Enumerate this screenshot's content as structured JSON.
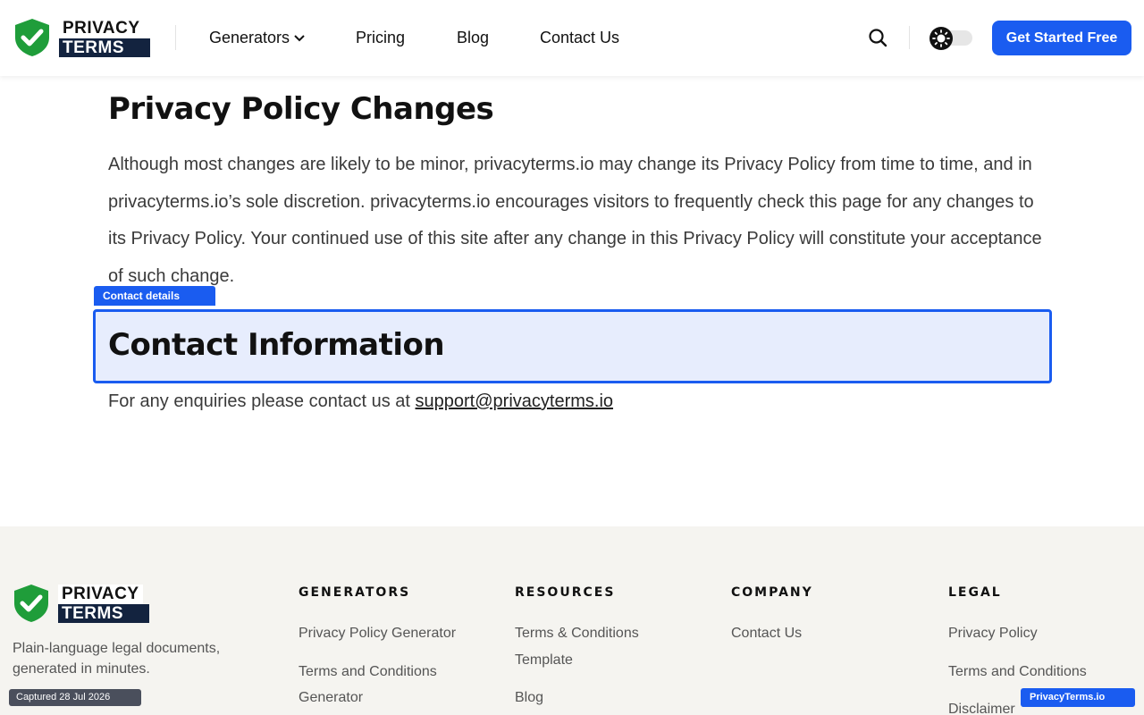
{
  "brand": {
    "word1": "PRIVACY",
    "word2": "TERMS"
  },
  "colors": {
    "accent": "#1a5cf0",
    "shield": "#1f9d3a",
    "logo_dark": "#13233f",
    "footer_bg": "#f5f4f0",
    "highlight_bg": "#e7edfd"
  },
  "nav": {
    "generators": "Generators",
    "pricing": "Pricing",
    "blog": "Blog",
    "contact": "Contact Us"
  },
  "icons": {
    "search": "search-icon",
    "theme": "sun-icon",
    "chevron": "chevron-down-icon",
    "shield": "shield-check-icon"
  },
  "cta": {
    "label": "Get Started Free"
  },
  "changes": {
    "title": "Privacy Policy Changes",
    "body": "Although most changes are likely to be minor, privacyterms.io may change its Privacy Policy from time to time, and in privacyterms.io’s sole discretion. privacyterms.io encourages visitors to frequently check this page for any changes to its Privacy Policy. Your continued use of this site after any change in this Privacy Policy will constitute your acceptance of such change."
  },
  "highlight": {
    "tag": "Contact details"
  },
  "contact": {
    "title": "Contact Information",
    "lead": "For any enquiries please contact us at ",
    "email": "support@privacyterms.io"
  },
  "footer": {
    "tagline": "Plain-language legal documents, generated in minutes.",
    "columns": [
      {
        "title": "GENERATORS",
        "links": [
          "Privacy Policy Generator",
          "Terms and Conditions Generator"
        ]
      },
      {
        "title": "RESOURCES",
        "links": [
          "Terms & Conditions Template",
          "Blog"
        ]
      },
      {
        "title": "COMPANY",
        "links": [
          "Contact Us"
        ]
      },
      {
        "title": "LEGAL",
        "links": [
          "Privacy Policy",
          "Terms and Conditions",
          "Disclaimer"
        ]
      }
    ]
  },
  "badges": {
    "captured": "Captured 28 Jul 2026",
    "site": "PrivacyTerms.io"
  }
}
